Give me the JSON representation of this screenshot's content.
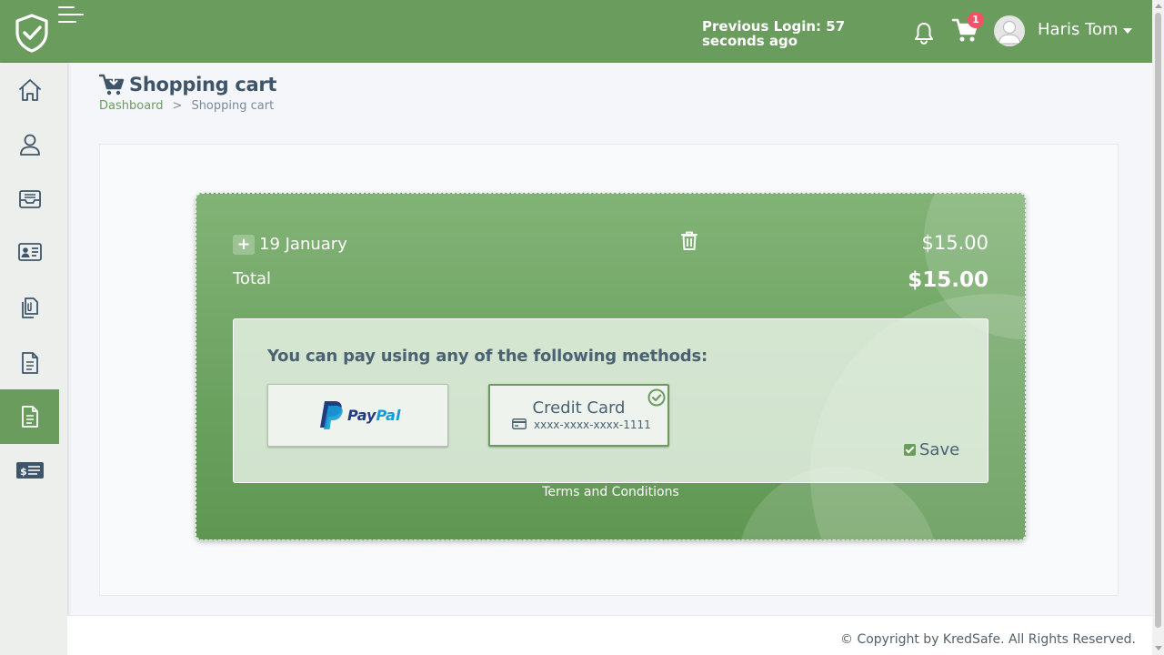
{
  "header": {
    "previous_login": "Previous Login: 57 seconds ago",
    "cart_count": "1",
    "user_name": "Haris Tom"
  },
  "sidebar": {
    "items": [
      {
        "icon": "home-icon"
      },
      {
        "icon": "user-icon"
      },
      {
        "icon": "inbox-icon"
      },
      {
        "icon": "id-card-icon"
      },
      {
        "icon": "documents-icon"
      },
      {
        "icon": "document-icon"
      },
      {
        "icon": "document-active-icon",
        "active": true
      },
      {
        "icon": "billing-icon"
      }
    ]
  },
  "page": {
    "title": "Shopping cart",
    "breadcrumb": {
      "home": "Dashboard",
      "separator": ">",
      "current": "Shopping cart"
    }
  },
  "cart": {
    "item_date": "19 January",
    "item_price": "$15.00",
    "total_label": "Total",
    "total_value": "$15.00",
    "plus_symbol": "+",
    "payment": {
      "title": "You can pay using any of the following methods:",
      "paypal_pay": "Pay",
      "paypal_pal": "Pal",
      "credit_title": "Credit Card",
      "credit_number": "xxxx-xxxx-xxxx-1111",
      "save_label": "Save",
      "save_checked": true
    },
    "terms": "Terms and Conditions"
  },
  "footer": {
    "copyright": "© Copyright by KredSafe. All Rights Reserved."
  },
  "colors": {
    "brand_green": "#6a9c5e",
    "badge_red": "#f25267",
    "text_dark": "#3e5569"
  }
}
